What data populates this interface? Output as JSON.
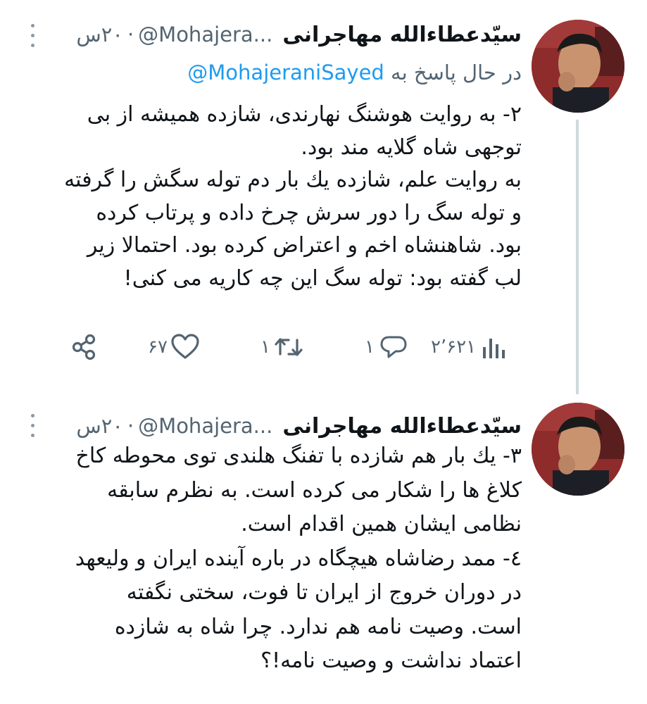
{
  "tweets": [
    {
      "author_name": "سیّدعطاءالله مهاجرانی",
      "handle": "@Mohajera...",
      "separator": "·",
      "time": "۲۰س",
      "replying_prefix": "در حال پاسخ به",
      "replying_to": "@MohajeraniSayed",
      "text_lines": [
        "۲- به روایت هوشنگ نهارندی، شازده همیشه از بی",
        "توجهی شاه گلایه مند بود.",
        "به روایت علم، شازده یك بار دم توله سگش را گرفته",
        "و توله سگ را دور سرش چرخ داده و پرتاب کرده",
        "بود. شاهنشاه اخم و اعتراض کرده بود. احتمالا زیر",
        "لب گفته بود: توله سگ این چه کاریه می کنی!"
      ],
      "views": "۲٬۶۲۱",
      "replies": "۱",
      "retweets": "۱",
      "likes": "۶۷"
    },
    {
      "author_name": "سیّدعطاءالله مهاجرانی",
      "handle": "@Mohajera...",
      "separator": "·",
      "time": "۲۰س",
      "text_lines": [
        "۳- یك بار هم شازده با تفنگ هلندی توی محوطه کاخ",
        "کلاغ ها را شکار می کرده است. به نظرم سابقه",
        "نظامی ایشان همین اقدام است.",
        "٤- ممد رضاشاه هیچگاه در باره آینده ایران و ولیعهد",
        "در دوران  خروج از ایران تا فوت، سختی نگفته",
        "است. وصیت نامه هم ندارد. چرا شاه به شازده",
        "اعتماد نداشت و وصیت نامه!؟"
      ]
    }
  ],
  "icons": {
    "views": "bar-chart-icon",
    "reply": "speech-bubble-icon",
    "retweet": "retweet-icon",
    "like": "heart-icon",
    "share": "share-icon",
    "more": "vertical-dots-icon"
  },
  "colors": {
    "text": "#0f1419",
    "secondary": "#536471",
    "link": "#1d9bf0",
    "thread_line": "#cfd9de"
  }
}
